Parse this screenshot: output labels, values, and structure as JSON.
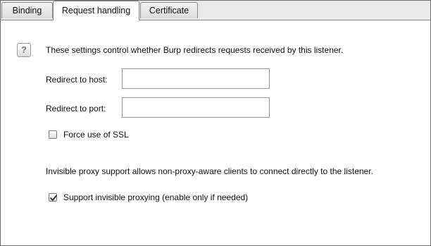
{
  "tabs": [
    {
      "label": "Binding",
      "active": false
    },
    {
      "label": "Request handling",
      "active": true
    },
    {
      "label": "Certificate",
      "active": false
    }
  ],
  "help_icon": {
    "glyph": "?",
    "icon": "help-icon"
  },
  "description": "These settings control whether Burp redirects requests received by this listener.",
  "redirect_host": {
    "label": "Redirect to host:",
    "value": ""
  },
  "redirect_port": {
    "label": "Redirect to port:",
    "value": ""
  },
  "force_ssl": {
    "label": "Force use of SSL",
    "checked": false
  },
  "invisible_note": "Invisible proxy support allows non-proxy-aware clients to connect directly to the listener.",
  "invisible_proxying": {
    "label": "Support invisible proxying (enable only if needed)",
    "checked": true
  },
  "colors": {
    "tab_bg": "#e9e9e9",
    "border": "#8a8a8a",
    "check": "#2b2b2b"
  }
}
